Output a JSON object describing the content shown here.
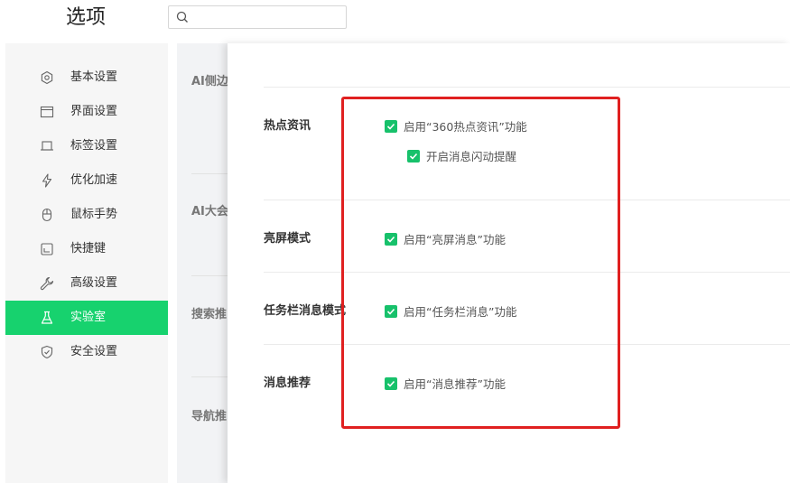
{
  "header": {
    "title": "选项",
    "search_placeholder": ""
  },
  "sidebar": {
    "items": [
      {
        "label": "基本设置",
        "icon": "gear-icon"
      },
      {
        "label": "界面设置",
        "icon": "window-icon"
      },
      {
        "label": "标签设置",
        "icon": "tab-icon"
      },
      {
        "label": "优化加速",
        "icon": "lightning-icon"
      },
      {
        "label": "鼠标手势",
        "icon": "mouse-icon"
      },
      {
        "label": "快捷键",
        "icon": "keyboard-icon"
      },
      {
        "label": "高级设置",
        "icon": "wrench-icon"
      },
      {
        "label": "实验室",
        "icon": "flask-icon",
        "active": true
      },
      {
        "label": "安全设置",
        "icon": "shield-icon"
      }
    ]
  },
  "background": {
    "labels": [
      "AI侧边",
      "AI大会",
      "搜索推",
      "导航推"
    ]
  },
  "lab": {
    "sections": [
      {
        "title": "热点资讯",
        "options": [
          {
            "label": "启用“360热点资讯”功能",
            "checked": true
          },
          {
            "label": "开启消息闪动提醒",
            "checked": true
          }
        ]
      },
      {
        "title": "亮屏模式",
        "options": [
          {
            "label": "启用“亮屏消息”功能",
            "checked": true
          }
        ]
      },
      {
        "title": "任务栏消息模式",
        "options": [
          {
            "label": "启用“任务栏消息”功能",
            "checked": true
          }
        ]
      },
      {
        "title": "消息推荐",
        "options": [
          {
            "label": "启用“消息推荐”功能",
            "checked": true
          }
        ]
      }
    ]
  },
  "colors": {
    "accent": "#17d26e",
    "checkbox": "#17c16b",
    "highlight_border": "#e02020"
  }
}
